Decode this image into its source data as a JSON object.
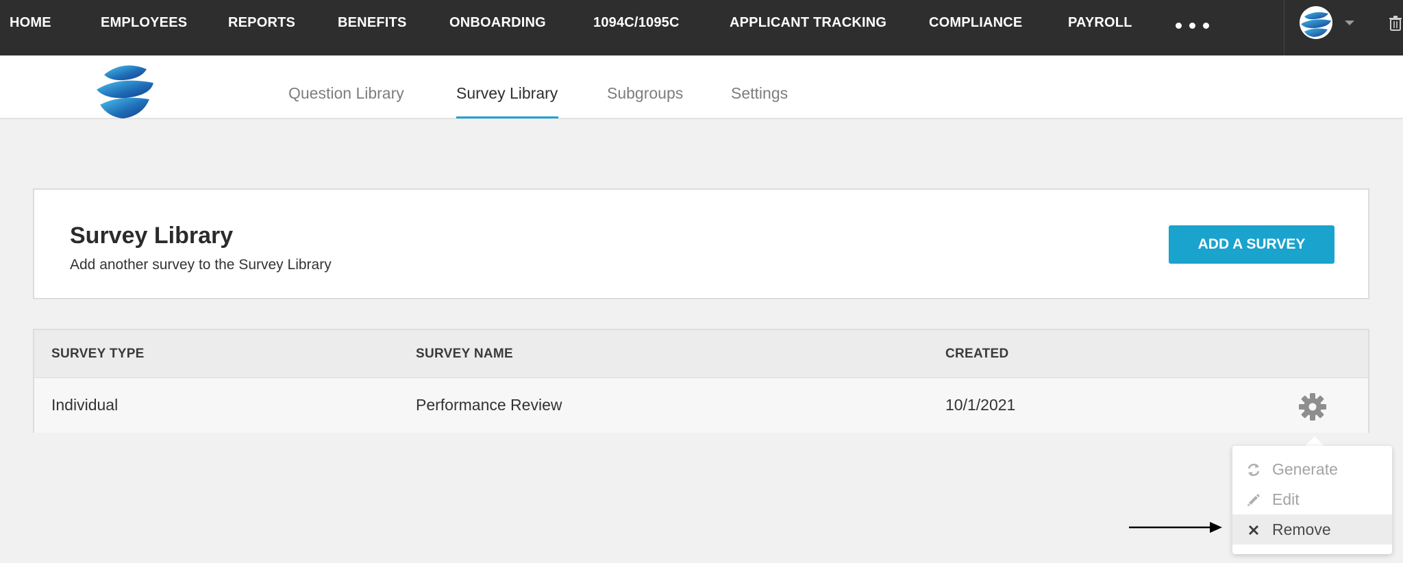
{
  "topnav": {
    "items": [
      "HOME",
      "EMPLOYEES",
      "REPORTS",
      "BENEFITS",
      "ONBOARDING",
      "1094C/1095C",
      "APPLICANT TRACKING",
      "COMPLIANCE",
      "PAYROLL"
    ],
    "more_icon": "ellipsis-icon",
    "avatar_icon": "globe-logo-icon",
    "caret_icon": "chevron-down-icon",
    "trash_icon": "trash-icon"
  },
  "subnav": {
    "logo_icon": "globe-logo-icon",
    "tabs": [
      "Question Library",
      "Survey Library",
      "Subgroups",
      "Settings"
    ],
    "active_tab": "Survey Library"
  },
  "header_card": {
    "title": "Survey Library",
    "subtitle": "Add another survey to the Survey Library",
    "add_button": "ADD A SURVEY"
  },
  "table": {
    "columns": [
      "SURVEY TYPE",
      "SURVEY NAME",
      "CREATED"
    ],
    "rows": [
      {
        "type": "Individual",
        "name": "Performance Review",
        "created": "10/1/2021"
      }
    ],
    "row_action_icon": "gear-icon"
  },
  "row_menu": {
    "items": [
      {
        "label": "Generate",
        "icon": "refresh-icon"
      },
      {
        "label": "Edit",
        "icon": "pencil-icon"
      },
      {
        "label": "Remove",
        "icon": "close-icon"
      }
    ],
    "highlighted": "Remove"
  },
  "colors": {
    "nav_bg": "#2e2e2e",
    "accent": "#1aa3cc",
    "tab_underline": "#1ea1d6",
    "page_bg": "#f1f1f1"
  }
}
